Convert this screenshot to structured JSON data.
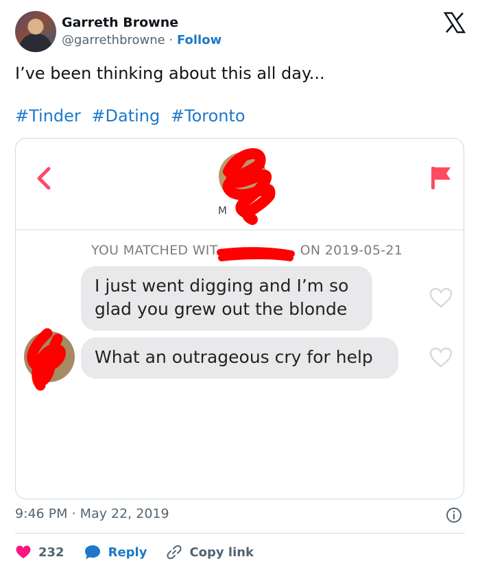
{
  "tweet": {
    "author_name": "Garreth Browne",
    "handle": "@garrethbrowne",
    "separator": "·",
    "follow_label": "Follow",
    "text": "I’ve been thinking about this all day...",
    "hashtags": [
      "#Tinder",
      "#Dating",
      "#Toronto"
    ],
    "timestamp": "9:46 PM · May 22, 2019"
  },
  "screenshot": {
    "match_name_partial": "M",
    "matched_prefix": "YOU MATCHED WIT",
    "matched_suffix": "ON 2019-05-21",
    "messages": [
      "I just went digging and I’m so glad you grew out the blonde",
      "What an outrageous cry for help"
    ]
  },
  "actions": {
    "like_count": "232",
    "reply_label": "Reply",
    "copy_link_label": "Copy link"
  },
  "colors": {
    "link_blue": "#1d79c8",
    "heart_pink": "#f91880",
    "tinder_red": "#fd4b5f",
    "redaction_red": "#ff0000"
  },
  "icons": {
    "platform": "x-logo-icon",
    "info": "info-icon",
    "like": "heart-icon",
    "reply": "reply-bubble-icon",
    "copy": "link-icon"
  }
}
